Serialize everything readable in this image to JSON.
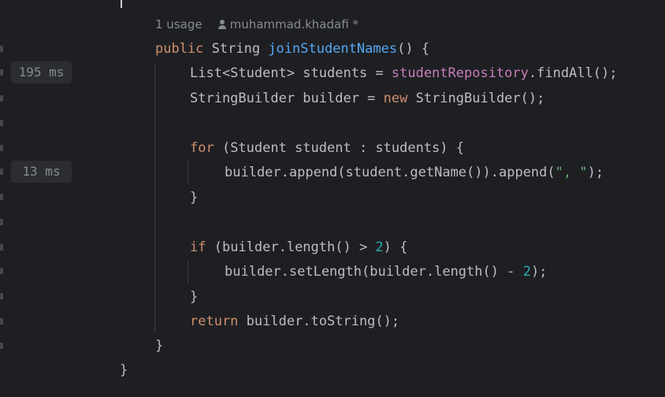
{
  "inlay": {
    "usages": "1 usage",
    "author": "muhammad.khadafi *"
  },
  "gutter": {
    "timings": [
      {
        "line": "findAll",
        "label": "195 ms"
      },
      {
        "line": "append",
        "label": "13 ms"
      }
    ]
  },
  "code": {
    "l1": {
      "kw": "public",
      "type": " String ",
      "fn": "joinStudentNames",
      "rest": "() {"
    },
    "l2": {
      "a": "List<Student> students = ",
      "field": "studentRepository",
      "b": ".findAll();"
    },
    "l3": {
      "a": "StringBuilder builder = ",
      "kw": "new",
      "b": " StringBuilder();"
    },
    "l4": {
      "kw": "for",
      "rest": " (Student student : students) {"
    },
    "l5": {
      "a": "builder.append(student.getName()).append(",
      "str": "\", \"",
      "b": ");"
    },
    "l6": {
      "text": "}"
    },
    "l7": {
      "kw": "if",
      "a": " (builder.length() > ",
      "num": "2",
      "b": ") {"
    },
    "l8": {
      "a": "builder.setLength(builder.length() - ",
      "num": "2",
      "b": ");"
    },
    "l9": {
      "text": "}"
    },
    "l10": {
      "kw": "return",
      "rest": " builder.toString();"
    },
    "l11": {
      "text": "}"
    },
    "l12": {
      "text": "}"
    }
  },
  "colors": {
    "background": "#1e1f22",
    "keyword": "#cf8e6d",
    "function": "#56a8f5",
    "field": "#c77dbb",
    "string": "#6aab73",
    "number": "#2aacb8",
    "text": "#bcbec4",
    "hint": "#868a91"
  }
}
